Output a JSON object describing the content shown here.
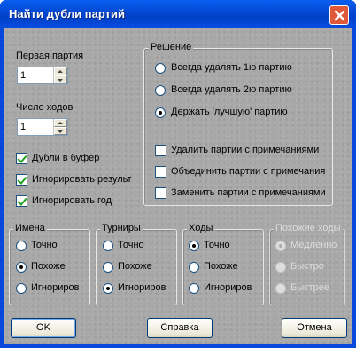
{
  "window": {
    "title": "Найти дубли партий"
  },
  "first_game": {
    "label": "Первая партия",
    "value": "1"
  },
  "moves_count": {
    "label": "Число ходов",
    "value": "1"
  },
  "checkboxes": [
    {
      "label": "Дубли в буфер",
      "checked": true
    },
    {
      "label": "Игнорировать результ",
      "checked": true
    },
    {
      "label": "Игнорировать год",
      "checked": true
    }
  ],
  "decision": {
    "title": "Решение",
    "radios": [
      {
        "label": "Всегда удалять 1ю партию",
        "checked": false
      },
      {
        "label": "Всегда удалять 2ю партию",
        "checked": false
      },
      {
        "label": "Держать 'лучшую' партию",
        "checked": true
      }
    ],
    "checkboxes": [
      {
        "label": "Удалить партии с примечаниями",
        "checked": false
      },
      {
        "label": "Объединить партии с примечания",
        "checked": false
      },
      {
        "label": "Заменить партии с примечаниями",
        "checked": false
      }
    ]
  },
  "groups": {
    "names": {
      "title": "Имена",
      "options": [
        "Точно",
        "Похоже",
        "Игнориров"
      ],
      "selected": 1
    },
    "tournaments": {
      "title": "Турниры",
      "options": [
        "Точно",
        "Похоже",
        "Игнориров"
      ],
      "selected": 2
    },
    "moves": {
      "title": "Ходы",
      "options": [
        "Точно",
        "Похоже",
        "Игнориров"
      ],
      "selected": 0
    },
    "similar_moves": {
      "title": "Похожие ходы",
      "options": [
        "Медленно",
        "Быстро",
        "Быстрее"
      ],
      "selected": 0,
      "disabled": true
    }
  },
  "buttons": {
    "ok": "OK",
    "help": "Справка",
    "cancel": "Отмена"
  },
  "icons": {
    "close": "close-icon"
  }
}
